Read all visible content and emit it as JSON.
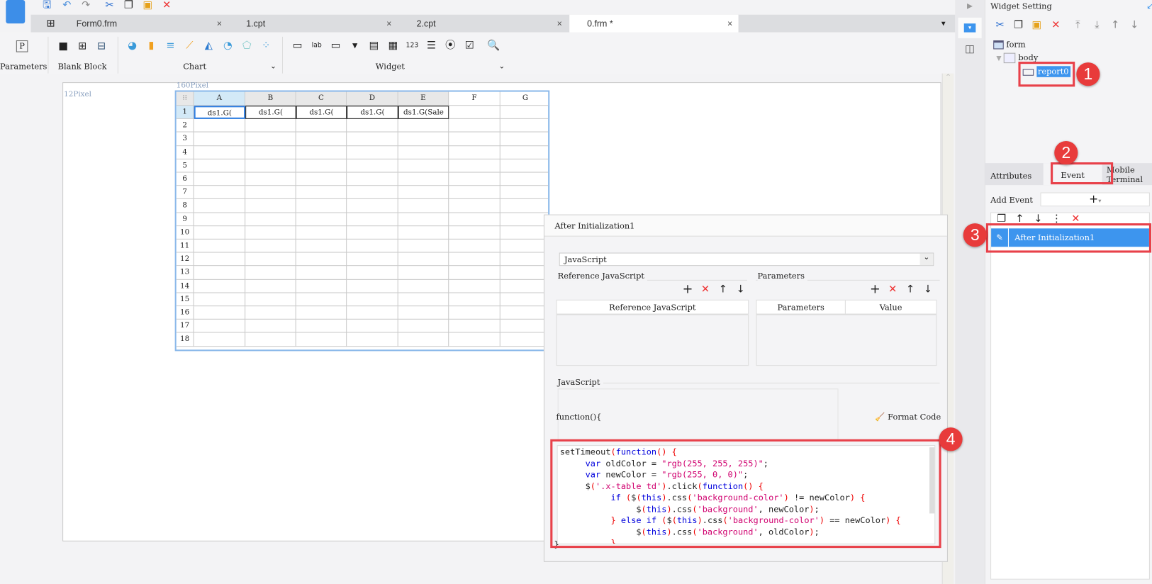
{
  "tabs": [
    {
      "label": "Form0.frm"
    },
    {
      "label": "1.cpt"
    },
    {
      "label": "2.cpt"
    },
    {
      "label": "0.frm *"
    }
  ],
  "ribbon": {
    "parameters": "Parameters",
    "param_icon": "P",
    "blank_block": "Blank Block",
    "chart": "Chart",
    "widget": "Widget"
  },
  "canvas": {
    "left_margin": "12Pixel",
    "top_margin": "160Pixel"
  },
  "sheet": {
    "columns": [
      "A",
      "B",
      "C",
      "D",
      "E",
      "F",
      "G"
    ],
    "rows": [
      "1",
      "2",
      "3",
      "4",
      "5",
      "6",
      "7",
      "8",
      "9",
      "10",
      "11",
      "12",
      "13",
      "14",
      "15",
      "16",
      "17",
      "18"
    ],
    "row1": [
      "ds1.G(",
      "ds1.G(",
      "ds1.G(",
      "ds1.G(",
      "ds1.G(Sale"
    ]
  },
  "dialog": {
    "title": "After Initialization1",
    "type_select": "JavaScript",
    "ref_js_legend": "Reference JavaScript",
    "ref_js_header": "Reference JavaScript",
    "params_legend": "Parameters",
    "params_header": "Parameters",
    "value_header": "Value",
    "js_legend": "JavaScript",
    "function_header": "function(){",
    "format_code": "Format Code",
    "code": {
      "l1a": "setTimeout",
      "l1b": "function",
      "l2a": "var",
      "l2b": " oldColor = ",
      "l2c": "\"rgb(255, 255, 255)\"",
      "l3a": "var",
      "l3b": " newColor = ",
      "l3c": "\"rgb(255, 0, 0)\"",
      "l4a": "'.x-table td'",
      "l4b": ".click",
      "l5a": "'background-color'",
      "l5b": " != newColor",
      "l6a": "'background'",
      "l6b": ", newColor",
      "l7a": "'background-color'",
      "l7b": " == newColor",
      "l8a": "'background'",
      "l8b": ", oldColor",
      "l10": "}"
    }
  },
  "panel": {
    "title": "Widget Setting",
    "tree": {
      "form": "form",
      "body": "body",
      "report": "report0"
    },
    "tabs": {
      "attributes": "Attributes",
      "event": "Event",
      "mobile1": "Mobile",
      "mobile2": "Terminal"
    },
    "add_event": "Add Event",
    "event_item": "After Initialization1"
  },
  "badges": [
    "1",
    "2",
    "3",
    "4"
  ],
  "colors": {
    "accent": "#3d95ee",
    "annotation": "#e8414a"
  }
}
